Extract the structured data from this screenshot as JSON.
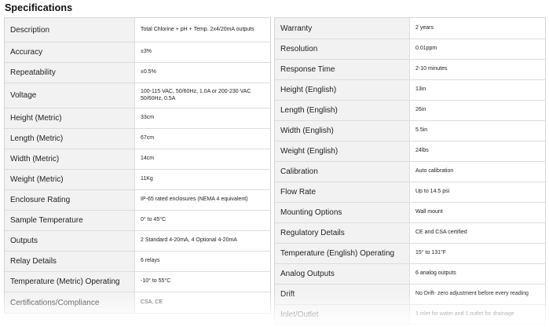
{
  "heading": "Specifications",
  "left_rows": [
    {
      "label": "Description",
      "value": "Total Chlorine + pH + Temp. 2x4/20mA outputs"
    },
    {
      "label": "Accuracy",
      "value": "±3%"
    },
    {
      "label": "Repeatability",
      "value": "±0.5%"
    },
    {
      "label": "Voltage",
      "value": "100-115 VAC, 50/60Hz, 1.0A or 200-230 VAC 50/60Hz, 0.5A"
    },
    {
      "label": "Height (Metric)",
      "value": "33cm"
    },
    {
      "label": "Length (Metric)",
      "value": "67cm"
    },
    {
      "label": "Width (Metric)",
      "value": "14cm"
    },
    {
      "label": "Weight (Metric)",
      "value": "11Kg"
    },
    {
      "label": "Enclosure Rating",
      "value": "IP-65 rated enclosures (NEMA 4 equivalent)"
    },
    {
      "label": "Sample Temperature",
      "value": "0° to 45°C"
    },
    {
      "label": "Outputs",
      "value": "2 Standard 4-20mA, 4 Optional 4-20mA"
    },
    {
      "label": "Relay Details",
      "value": "6 relays"
    },
    {
      "label": "Temperature (Metric) Operating",
      "value": "-10° to 55°C"
    },
    {
      "label": "Certifications/Compliance",
      "value": "CSA, CE"
    }
  ],
  "right_rows": [
    {
      "label": "Warranty",
      "value": "2 years"
    },
    {
      "label": "Resolution",
      "value": "0.01ppm"
    },
    {
      "label": "Response Time",
      "value": "2-10 minutes"
    },
    {
      "label": "Height (English)",
      "value": "13in"
    },
    {
      "label": "Length (English)",
      "value": "26in"
    },
    {
      "label": "Width (English)",
      "value": "5.5in"
    },
    {
      "label": "Weight (English)",
      "value": "24lbs"
    },
    {
      "label": "Calibration",
      "value": "Auto calibration"
    },
    {
      "label": "Flow Rate",
      "value": "Up to 14.5 psi"
    },
    {
      "label": "Mounting Options",
      "value": "Wall mount"
    },
    {
      "label": "Regulatory Details",
      "value": "CE and CSA certified"
    },
    {
      "label": "Temperature (English) Operating",
      "value": "15° to 131°F"
    },
    {
      "label": "Analog Outputs",
      "value": "6 analog outputs"
    },
    {
      "label": "Drift",
      "value": "No Drift- zero adjustment before every reading"
    },
    {
      "label": "Inlet/Outlet",
      "value": "1 inlet for water and 1 outlet for drainage"
    }
  ]
}
